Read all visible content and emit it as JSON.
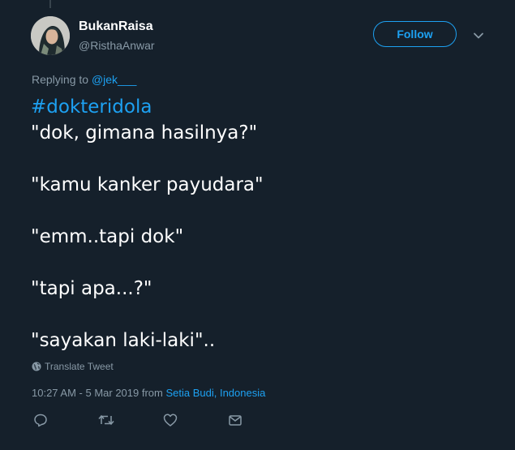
{
  "user": {
    "display_name": "BukanRaisa",
    "username": "@RisthaAnwar"
  },
  "header": {
    "follow_label": "Follow",
    "menu_icon": "chevron-down-icon"
  },
  "reply_context": {
    "prefix": "Replying to ",
    "mention": "@jek___"
  },
  "tweet": {
    "hashtag": "#dokteridola",
    "lines": [
      "\"dok, gimana hasilnya?\"",
      "\"kamu kanker payudara\"",
      "\"emm..tapi dok\"",
      "\"tapi apa...?\"",
      "\"sayakan laki-laki\".."
    ]
  },
  "translate_label": "Translate Tweet",
  "meta": {
    "time": "10:27 AM - 5 Mar 2019 from ",
    "location": "Setia Budi, Indonesia"
  },
  "actions": {
    "reply_icon": "reply-icon",
    "retweet_icon": "retweet-icon",
    "like_icon": "heart-icon",
    "dm_icon": "envelope-icon"
  },
  "colors": {
    "background": "#15202b",
    "accent": "#1da1f2",
    "secondary_text": "#8899a6"
  }
}
